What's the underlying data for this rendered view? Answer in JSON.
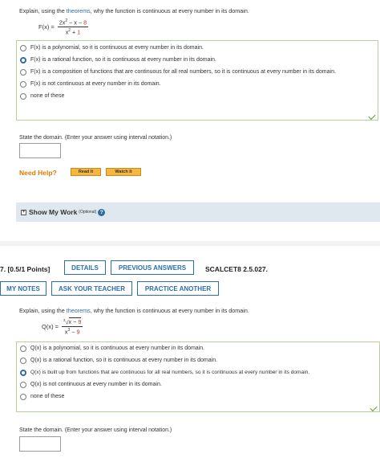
{
  "q1": {
    "intro_pre": "Explain, using the ",
    "intro_link": "theorems",
    "intro_post": ", why the function is continuous at every number in its domain.",
    "func_label": "F(x) = ",
    "num_a": "2x",
    "num_sup": "2",
    "num_b": " − x − ",
    "num_c": "8",
    "den_a": "x",
    "den_sup": "2",
    "den_b": " + ",
    "den_c": "1",
    "options": [
      {
        "text": "F(x) is a polynomial, so it is continuous at every number in its domain.",
        "selected": false
      },
      {
        "text": "F(x) is a rational function, so it is continuous at every number in its domain.",
        "selected": true
      },
      {
        "text": "F(x) is a composition of functions that are continuous for all real numbers, so it is continuous at every number in its domain.",
        "selected": false
      },
      {
        "text": "F(x) is not continuous at every number in its domain.",
        "selected": false
      },
      {
        "text": "none of these",
        "selected": false
      }
    ],
    "domain_prompt": "State the domain. (Enter your answer using interval notation.)",
    "domain_value": ""
  },
  "help": {
    "label": "Need Help?",
    "read_it": "Read It",
    "watch_it": "Watch It"
  },
  "show_work": {
    "plus": "+",
    "label": "Show My Work",
    "optional": "(Optional)",
    "help_glyph": "?"
  },
  "q2_header": {
    "points": "7. [0.5/1 Points]",
    "details": "DETAILS",
    "previous_answers": "PREVIOUS ANSWERS",
    "book_code": "SCALCET8 2.5.027.",
    "my_notes": "MY NOTES",
    "ask_teacher": "ASK YOUR TEACHER",
    "practice": "PRACTICE ANOTHER"
  },
  "q2": {
    "intro_pre": "Explain, using the ",
    "intro_link": "theorems",
    "intro_post": ", why the function is continuous at every number in its domain.",
    "func_label": "Q(x) = ",
    "num_root": "3",
    "num_a": "x − ",
    "num_c": "9",
    "den_a": "x",
    "den_sup": "3",
    "den_b": " − ",
    "den_c": "9",
    "options": [
      {
        "text": "Q(x) is a polynomial, so it is continuous at every number in its domain.",
        "selected": false
      },
      {
        "text": "Q(x) is a rational function, so it is continuous at every number in its domain.",
        "selected": false
      },
      {
        "text": "Q(x) is built up from functions that are continuous for all real numbers, so it is continuous at every number in its domain.",
        "selected": true
      },
      {
        "text": "Q(x) is not continuous at every number in its domain.",
        "selected": false
      },
      {
        "text": "none of these",
        "selected": false
      }
    ],
    "domain_prompt": "State the domain. (Enter your answer using interval notation.)",
    "domain_value": ""
  },
  "colors": {
    "accent": "#2f6da6",
    "correct_border": "#b8cf9e",
    "correct_check": "#5aa02c",
    "need_help": "#e07b00",
    "help_btn": "#f6b73c",
    "formula_red": "#c0392b"
  }
}
